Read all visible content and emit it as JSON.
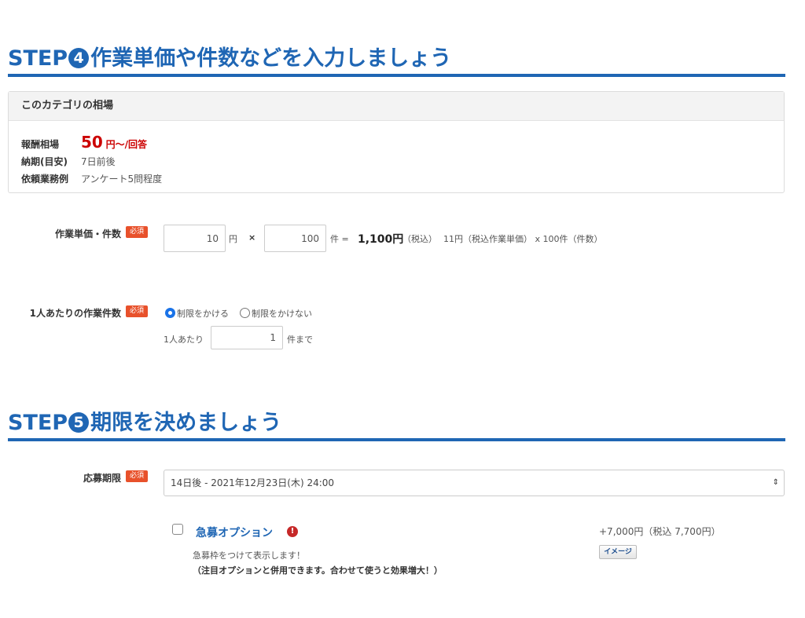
{
  "step4": {
    "prefix": "STEP",
    "number": "4",
    "title": "作業単価や件数などを入力しましょう"
  },
  "market": {
    "header": "このカテゴリの相場",
    "reward_label": "報酬相場",
    "reward_value": "50",
    "reward_unit": "円〜/回答",
    "deadline_label": "納期(目安)",
    "deadline_value": "7日前後",
    "example_label": "依頼業務例",
    "example_value": "アンケート5問程度"
  },
  "unit_price_row": {
    "label": "作業単価・件数",
    "required": "必須",
    "price_value": "10",
    "price_unit": "円",
    "times": "×",
    "count_value": "100",
    "count_unit": "件 =",
    "total": "1,100円",
    "tax_note": "（税込）",
    "breakdown": "11円（税込作業単価） x 100件（件数）"
  },
  "per_person_row": {
    "label": "1人あたりの作業件数",
    "required": "必須",
    "radio_limit": "制限をかける",
    "radio_nolimit": "制限をかけない",
    "per_person_prefix": "1人あたり",
    "per_person_value": "1",
    "per_person_suffix": "件まで"
  },
  "step5": {
    "prefix": "STEP",
    "number": "5",
    "title": "期限を決めましょう"
  },
  "deadline_row": {
    "label": "応募期限",
    "required": "必須",
    "selected": "14日後 - 2021年12月23日(木) 24:00"
  },
  "urgent_option": {
    "title": "急募オプション",
    "price": "+7,000円（税込 7,700円）",
    "desc1": "急募枠をつけて表示します！",
    "desc2": "（注目オプションと併用できます。合わせて使うと効果増大！）",
    "image_button": "イメージ"
  },
  "colors": {
    "accent": "#1f66b4",
    "required_badge": "#e8512b",
    "price_red": "#cc0000"
  }
}
